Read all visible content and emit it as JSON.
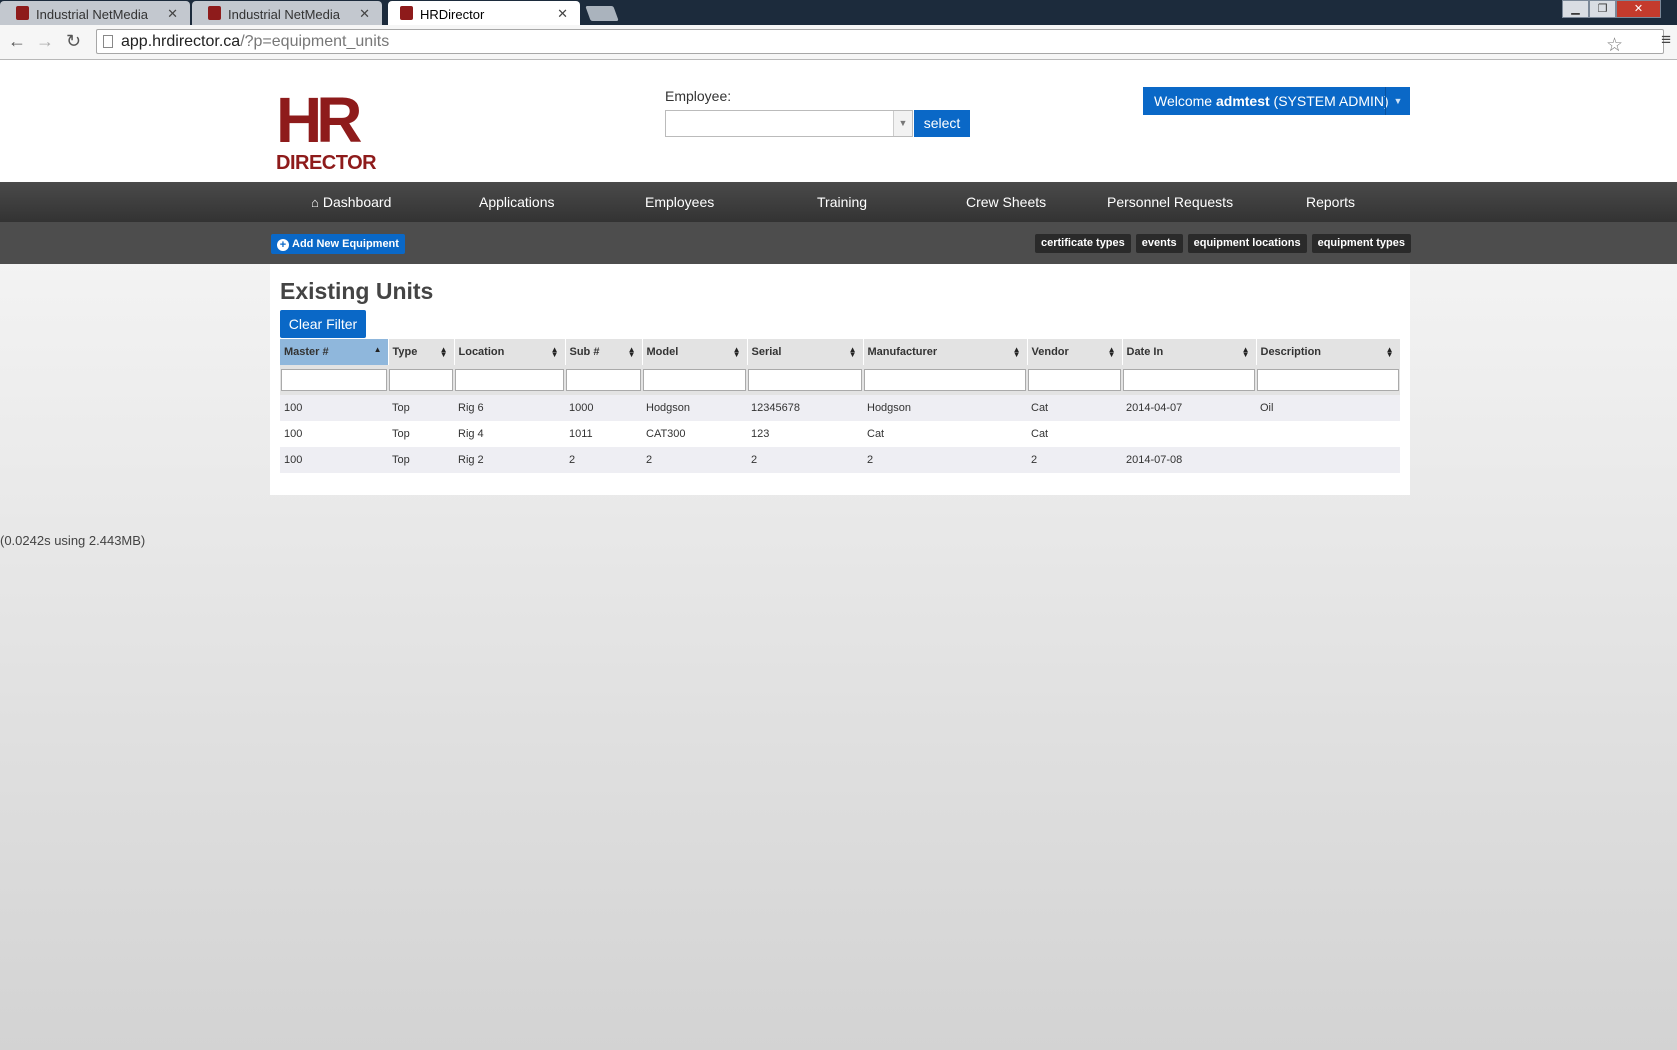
{
  "browser": {
    "tabs": [
      {
        "title": "Industrial NetMedia"
      },
      {
        "title": "Industrial NetMedia"
      },
      {
        "title": "HRDirector"
      }
    ],
    "url_host": "app.hrdirector.ca",
    "url_path": "/?p=equipment_units"
  },
  "header": {
    "logo_hr": "HR",
    "logo_director": "DIRECTOR",
    "employee_label": "Employee:",
    "employee_value": "",
    "select_label": "select",
    "welcome_prefix": "Welcome ",
    "welcome_user": "admtest",
    "welcome_role": " (SYSTEM ADMIN)"
  },
  "nav": {
    "items": [
      "Dashboard",
      "Applications",
      "Employees",
      "Training",
      "Crew Sheets",
      "Personnel Requests",
      "Reports"
    ]
  },
  "subnav": {
    "add_label": "Add New Equipment",
    "links": [
      "certificate types",
      "events",
      "equipment locations",
      "equipment types"
    ]
  },
  "main": {
    "title": "Existing Units",
    "clear_filter_label": "Clear Filter",
    "columns": [
      "Master #",
      "Type",
      "Location",
      "Sub #",
      "Model",
      "Serial",
      "Manufacturer",
      "Vendor",
      "Date In",
      "Description"
    ],
    "rows": [
      [
        "100",
        "Top",
        "Rig 6",
        "1000",
        "Hodgson",
        "12345678",
        "Hodgson",
        "Cat",
        "2014-04-07",
        "Oil"
      ],
      [
        "100",
        "Top",
        "Rig 4",
        "1011",
        "CAT300",
        "123",
        "Cat",
        "Cat",
        "",
        ""
      ],
      [
        "100",
        "Top",
        "Rig 2",
        "2",
        "2",
        "2",
        "2",
        "2",
        "2014-07-08",
        ""
      ]
    ]
  },
  "footer": {
    "stats": "(0.0242s using 2.443MB)"
  },
  "colors": {
    "brand_red": "#8e1b1b",
    "primary_blue": "#0a68c7",
    "nav_dark": "#333333"
  }
}
